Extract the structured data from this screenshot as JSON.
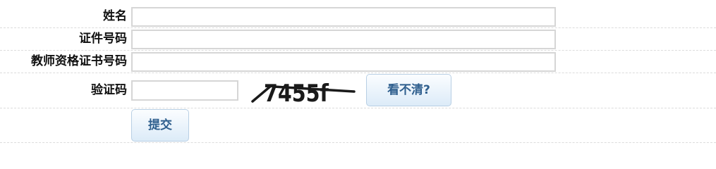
{
  "form": {
    "name_label": "姓名",
    "name_value": "",
    "id_label": "证件号码",
    "id_value": "",
    "cert_label": "教师资格证书号码",
    "cert_value": "",
    "captcha_label": "验证码",
    "captcha_value": "",
    "captcha_image_text": "7455f",
    "refresh_label": "看不清?",
    "submit_label": "提交"
  }
}
